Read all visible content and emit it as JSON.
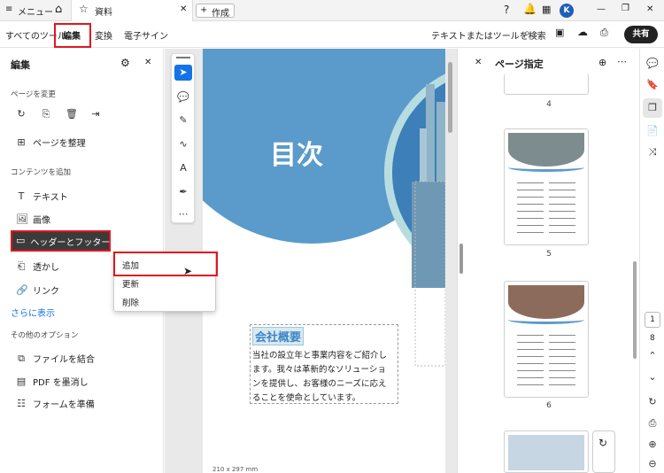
{
  "tabbar": {
    "menu_label": "メニュー",
    "doc_tab": "資料",
    "new_tab": "作成",
    "account_initial": "K"
  },
  "menubar": {
    "items": [
      "すべてのツール",
      "編集",
      "変換",
      "電子サイン"
    ],
    "search": "テキストまたはツールを検索",
    "share": "共有"
  },
  "left_panel": {
    "title": "編集",
    "section_pages": "ページを変更",
    "organize": "ページを整理",
    "section_content": "コンテンツを追加",
    "text": "テキスト",
    "image": "画像",
    "header_footer": "ヘッダーとフッター",
    "watermark": "透かし",
    "link": "リンク",
    "show_more": "さらに表示",
    "section_other": "その他のオプション",
    "combine": "ファイルを結合",
    "redact": "PDF を墨消し",
    "prepare_form": "フォームを準備"
  },
  "dropdown": {
    "items": [
      "追加",
      "更新",
      "削除"
    ]
  },
  "page": {
    "title": "目次",
    "heading": "会社概要",
    "body": [
      "当社の設立年と事業内容をご紹介し",
      "ます。我々は革新的なソリューショ",
      "ンを提供し、お客様のニーズに応え",
      "ることを使命としています。"
    ],
    "size": "210 x 297 mm"
  },
  "page_panel": {
    "title": "ページ指定",
    "page_numbers": [
      "4",
      "5",
      "6"
    ]
  },
  "rail": {
    "current_page": "1",
    "total_pages": "8"
  },
  "colors": {
    "accent_blue": "#1473e6",
    "circle_blue": "#5b9bcb",
    "red_highlight": "#e0161e",
    "heading_blue": "#3b86c4"
  }
}
